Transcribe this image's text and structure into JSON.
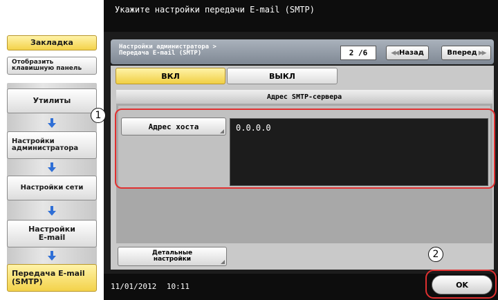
{
  "header": {
    "title": "Укажите настройки передачи  E-mail (SMTP)"
  },
  "sidebar": {
    "bookmark": "Закладка",
    "show_keyboard": "Отобразить клавишную панель",
    "path": [
      "Утилиты",
      "Настройки администратора",
      "Настройки сети",
      "Настройки E-mail",
      "Передача E-mail (SMTP)"
    ]
  },
  "subheader": {
    "title_line1": "Настройки администратора >",
    "title_line2": "Передача E-mail (SMTP)",
    "page_indicator": "2 /6",
    "back_label": "Назад",
    "forward_label": "Вперед"
  },
  "toggle": {
    "on_label": "ВКЛ",
    "off_label": "ВЫКЛ",
    "selected": "ВКЛ"
  },
  "smtp": {
    "group_title": "Адрес SMTP-сервера",
    "host_label": "Адрес хоста",
    "host_value": "0.0.0.0"
  },
  "detail_button": {
    "line1": "Детальные",
    "line2": "настройки"
  },
  "status": {
    "date": "11/01/2012",
    "time": "10:11"
  },
  "ok_label": "OK",
  "callouts": [
    "1",
    "2"
  ],
  "colors": {
    "selected_yellow": "#f0cf44",
    "callout_red": "#e03030",
    "title_black": "#0d0d0d"
  }
}
